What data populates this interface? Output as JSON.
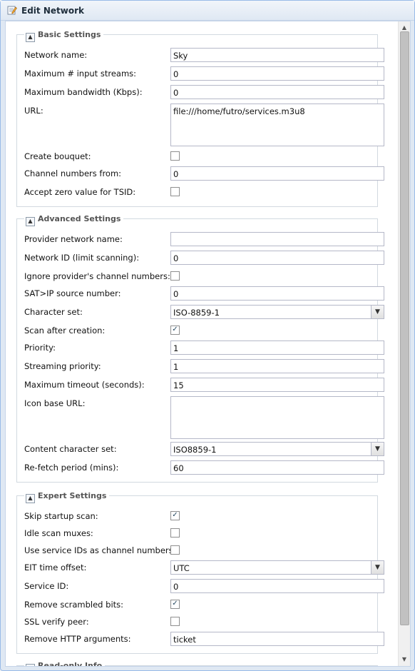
{
  "window": {
    "title": "Edit Network",
    "icon": "edit-icon"
  },
  "basic": {
    "legend": "Basic Settings",
    "network_name_label": "Network name:",
    "network_name": "Sky",
    "max_streams_label": "Maximum # input streams:",
    "max_streams": "0",
    "max_bw_label": "Maximum bandwidth (Kbps):",
    "max_bw": "0",
    "url_label": "URL:",
    "url": "file:///home/futro/services.m3u8",
    "create_bouquet_label": "Create bouquet:",
    "chan_from_label": "Channel numbers from:",
    "chan_from": "0",
    "zero_tsid_label": "Accept zero value for TSID:"
  },
  "advanced": {
    "legend": "Advanced Settings",
    "provider_label": "Provider network name:",
    "provider": "",
    "netid_label": "Network ID (limit scanning):",
    "netid": "0",
    "ignore_label": "Ignore provider's channel numbers:",
    "satip_label": "SAT>IP source number:",
    "satip": "0",
    "charset_label": "Character set:",
    "charset": "ISO-8859-1",
    "scan_label": "Scan after creation:",
    "priority_label": "Priority:",
    "priority": "1",
    "stream_prio_label": "Streaming priority:",
    "stream_prio": "1",
    "timeout_label": "Maximum timeout (seconds):",
    "timeout": "15",
    "icon_url_label": "Icon base URL:",
    "icon_url": "",
    "content_charset_label": "Content character set:",
    "content_charset": "ISO8859-1",
    "refetch_label": "Re-fetch period (mins):",
    "refetch": "60"
  },
  "expert": {
    "legend": "Expert Settings",
    "skip_label": "Skip startup scan:",
    "idle_label": "Idle scan muxes:",
    "sid_chan_label": "Use service IDs as channel numbers:",
    "eit_label": "EIT time offset:",
    "eit": "UTC",
    "service_id_label": "Service ID:",
    "service_id": "0",
    "scrambled_label": "Remove scrambled bits:",
    "ssl_label": "SSL verify peer:",
    "http_args_label": "Remove HTTP arguments:",
    "http_args": "ticket"
  },
  "readonly": {
    "legend": "Read-only Info"
  },
  "checkboxes": {
    "create_bouquet": false,
    "zero_tsid": false,
    "ignore": false,
    "scan": true,
    "skip": true,
    "idle": false,
    "sid_chan": false,
    "scrambled": true,
    "ssl": false
  },
  "colors": {
    "border": "#99bbe8",
    "check": "#23475f"
  }
}
